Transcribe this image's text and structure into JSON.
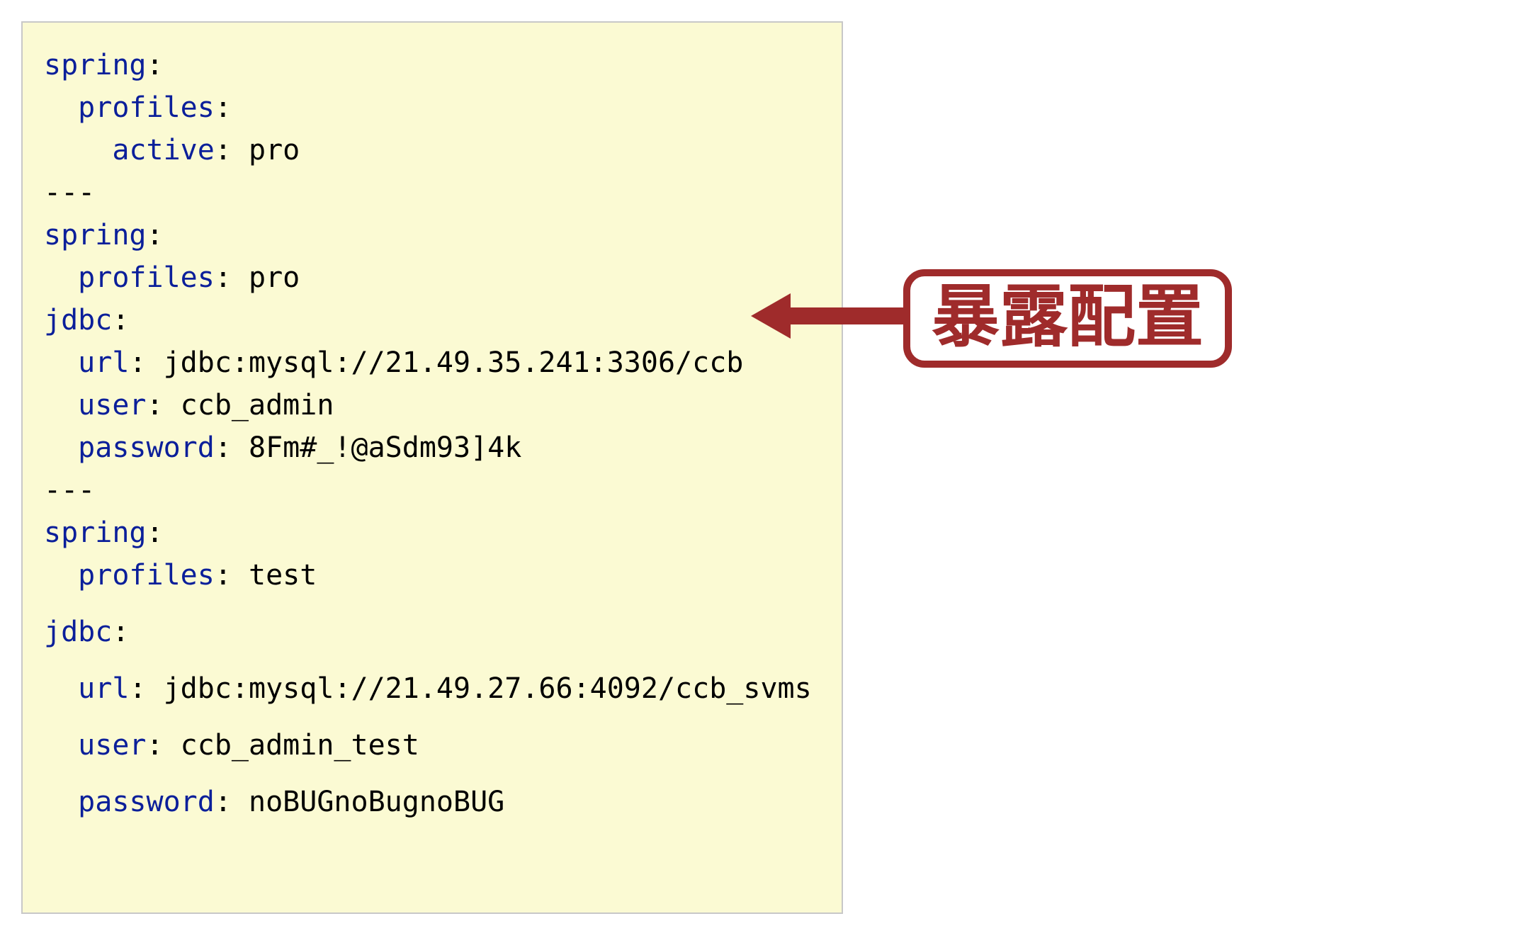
{
  "yaml": {
    "block1": {
      "k_spring": "spring",
      "k_profiles": "profiles",
      "k_active": "active",
      "v_active": "pro"
    },
    "sep": "---",
    "block2": {
      "k_spring": "spring",
      "k_profiles": "profiles",
      "v_profiles": "pro",
      "k_jdbc": "jdbc",
      "k_url": "url",
      "v_url": "jdbc:mysql://21.49.35.241:3306/ccb",
      "k_user": "user",
      "v_user": "ccb_admin",
      "k_password": "password",
      "v_password": "8Fm#_!@aSdm93]4k"
    },
    "block3": {
      "k_spring": "spring",
      "k_profiles": "profiles",
      "v_profiles": "test",
      "k_jdbc": "jdbc",
      "k_url": "url",
      "v_url": "jdbc:mysql://21.49.27.66:4092/ccb_svms",
      "k_user": "user",
      "v_user": "ccb_admin_test",
      "k_password": "password",
      "v_password": "noBUGnoBugnoBUG"
    }
  },
  "callout": {
    "label": "暴露配置"
  }
}
